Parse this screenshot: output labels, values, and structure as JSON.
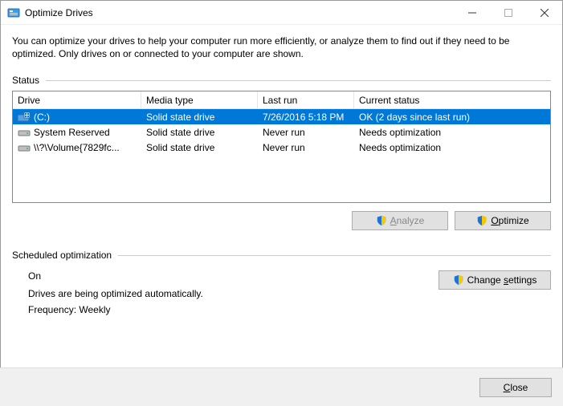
{
  "window": {
    "title": "Optimize Drives"
  },
  "intro": "You can optimize your drives to help your computer run more efficiently, or analyze them to find out if they need to be optimized. Only drives on or connected to your computer are shown.",
  "status_label": "Status",
  "columns": {
    "drive": "Drive",
    "media": "Media type",
    "last": "Last run",
    "status": "Current status"
  },
  "drives": [
    {
      "name": "(C:)",
      "media": "Solid state drive",
      "last": "7/26/2016 5:18 PM",
      "status": "OK (2 days since last run)",
      "selected": true,
      "icon": "os"
    },
    {
      "name": "System Reserved",
      "media": "Solid state drive",
      "last": "Never run",
      "status": "Needs optimization",
      "selected": false,
      "icon": "hdd"
    },
    {
      "name": "\\\\?\\Volume{7829fc...",
      "media": "Solid state drive",
      "last": "Never run",
      "status": "Needs optimization",
      "selected": false,
      "icon": "hdd"
    }
  ],
  "buttons": {
    "analyze": "Analyze",
    "optimize": "Optimize",
    "change_settings": "Change settings",
    "close": "Close"
  },
  "scheduled": {
    "label": "Scheduled optimization",
    "state": "On",
    "desc": "Drives are being optimized automatically.",
    "freq": "Frequency: Weekly"
  }
}
